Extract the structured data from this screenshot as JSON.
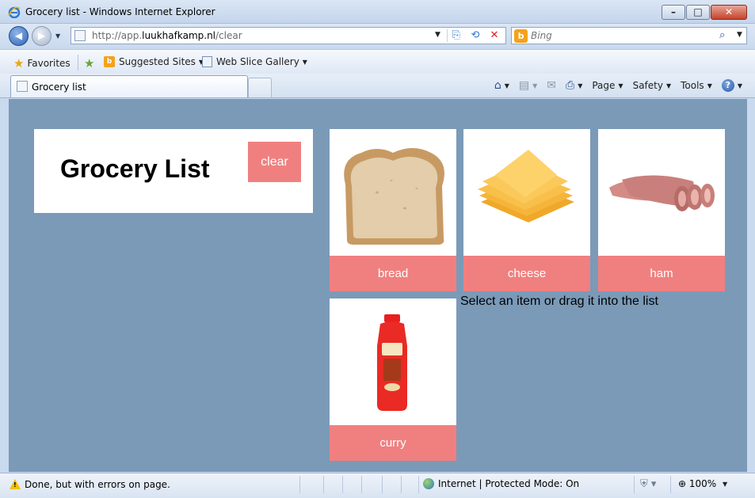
{
  "window": {
    "title": "Grocery list - Windows Internet Explorer",
    "minimize_glyph": "–",
    "maximize_glyph": "□",
    "close_glyph": "✕"
  },
  "address_bar": {
    "url_prefix": "http://app.",
    "url_domain": "luukhafkamp.nl",
    "url_path": "/clear"
  },
  "search": {
    "placeholder": "Bing",
    "provider_icon": "bing-icon"
  },
  "favorites_bar": {
    "favorites_label": "Favorites",
    "items": [
      {
        "label": "Suggested Sites",
        "icon": "bing-icon"
      },
      {
        "label": "Web Slice Gallery",
        "icon": "page-icon"
      }
    ]
  },
  "tab": {
    "label": "Grocery list"
  },
  "command_bar": {
    "page_label": "Page",
    "safety_label": "Safety",
    "tools_label": "Tools",
    "help_glyph": "?"
  },
  "content": {
    "list_title": "Grocery List",
    "clear_label": "clear",
    "hint": "Select an item or drag it into the list",
    "items": [
      {
        "label": "bread",
        "icon": "bread-image"
      },
      {
        "label": "cheese",
        "icon": "cheese-image"
      },
      {
        "label": "ham",
        "icon": "ham-image"
      },
      {
        "label": "curry",
        "icon": "curry-bottle-image"
      }
    ]
  },
  "status_bar": {
    "status_text": "Done, but with errors on page.",
    "zone_text": "Internet | Protected Mode: On",
    "zoom": "100%"
  },
  "colors": {
    "page_background": "#7b9ab8",
    "accent": "#f08080",
    "card": "#ffffff"
  }
}
